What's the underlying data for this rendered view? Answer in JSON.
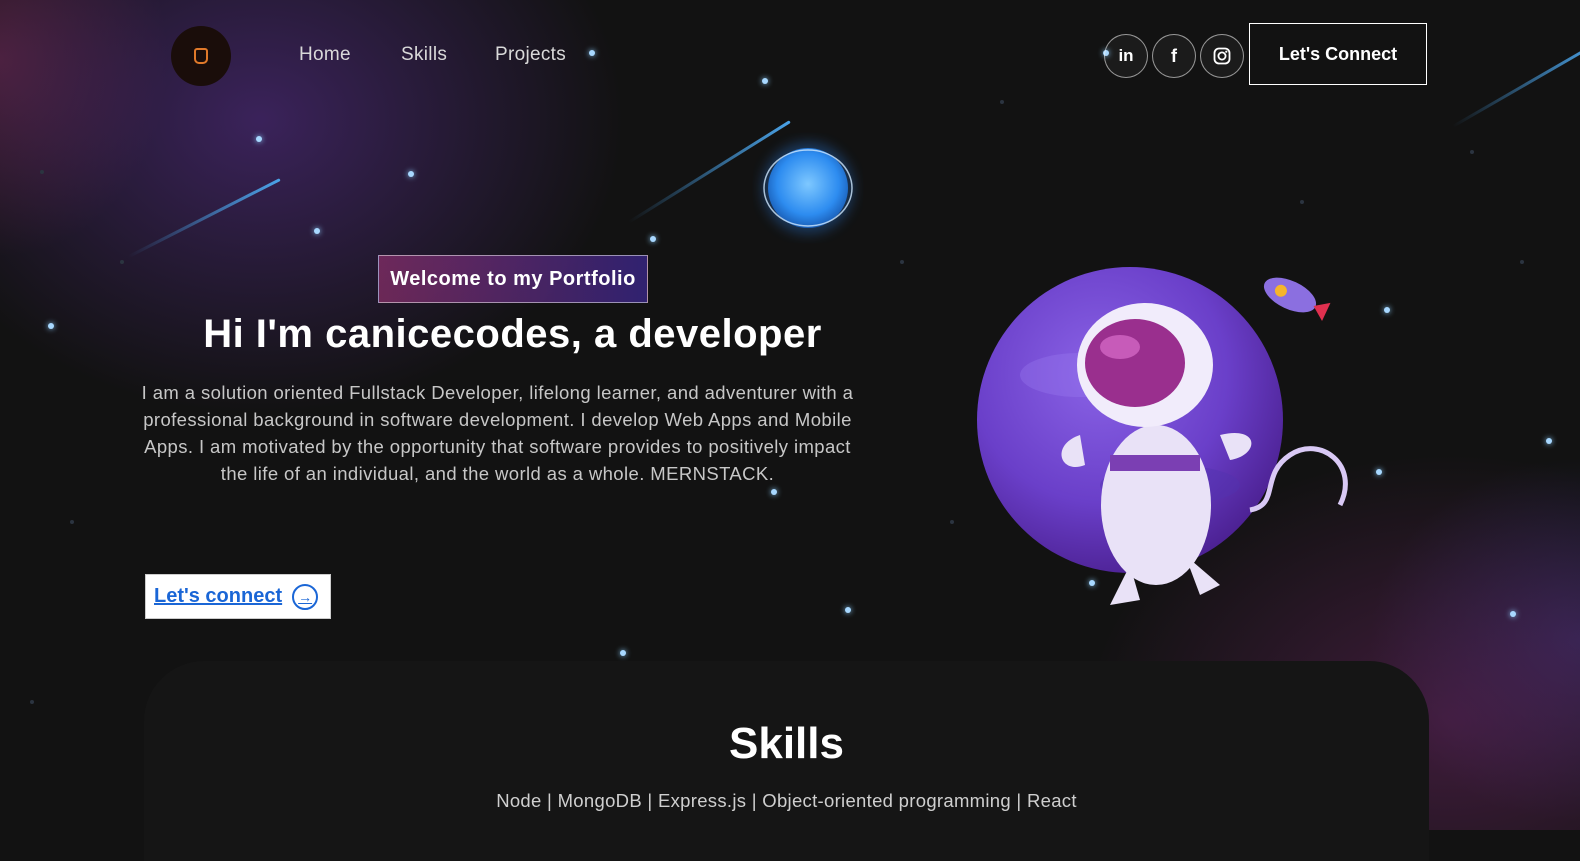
{
  "nav": {
    "links": [
      "Home",
      "Skills",
      "Projects"
    ],
    "social": [
      {
        "name": "linkedin-icon",
        "glyph": "in"
      },
      {
        "name": "facebook-icon",
        "glyph": "f"
      },
      {
        "name": "instagram-icon",
        "glyph": ""
      }
    ],
    "connect_label": "Let's Connect"
  },
  "hero": {
    "tagline": "Welcome to my Portfolio",
    "headline": "Hi I'm canicecodes, a developer",
    "bio": "I am a solution oriented Fullstack Developer, lifelong learner, and adventurer with a professional background in software development. I develop Web Apps and Mobile Apps. I am motivated by the opportunity that software provides to positively impact the life of an individual, and the world as a whole. MERNSTACK.",
    "cta_label": "Let's connect"
  },
  "skills": {
    "title": "Skills",
    "list": "Node | MongoDB | Express.js | Object-oriented programming | React"
  },
  "colors": {
    "background": "#121212",
    "accent_pink": "#aa367c",
    "accent_purple": "#4a2fbd",
    "link_blue": "#1a66d6"
  }
}
